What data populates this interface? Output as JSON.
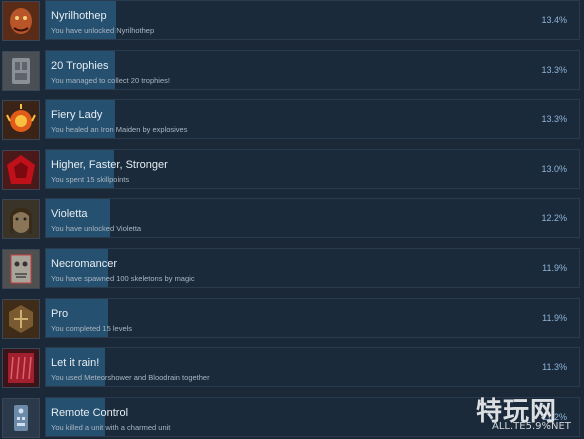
{
  "achievements": [
    {
      "title": "Nyrilhothep",
      "description": "You have unlocked Nyrilhothep",
      "percent": "13.4%",
      "rate": 13.4,
      "icon": "nyrilhothep-icon",
      "icon_color": "#b8562a"
    },
    {
      "title": "20 Trophies",
      "description": "You managed to collect 20 trophies!",
      "percent": "13.3%",
      "rate": 13.3,
      "icon": "trophies-icon",
      "icon_color": "#8a9098"
    },
    {
      "title": "Fiery Lady",
      "description": "You healed an Iron Maiden by explosives",
      "percent": "13.3%",
      "rate": 13.3,
      "icon": "fiery-lady-icon",
      "icon_color": "#e05a1a"
    },
    {
      "title": "Higher, Faster, Stronger",
      "description": "You spent 15 skillpoints",
      "percent": "13.0%",
      "rate": 13.0,
      "icon": "skillpoints-icon",
      "icon_color": "#c0101a"
    },
    {
      "title": "Violetta",
      "description": "You have unlocked Violetta",
      "percent": "12.2%",
      "rate": 12.2,
      "icon": "violetta-icon",
      "icon_color": "#8a7558"
    },
    {
      "title": "Necromancer",
      "description": "You have spawned 100 skeletons by magic",
      "percent": "11.9%",
      "rate": 11.9,
      "icon": "necromancer-icon",
      "icon_color": "#a8a49a"
    },
    {
      "title": "Pro",
      "description": "You completed 15 levels",
      "percent": "11.9%",
      "rate": 11.9,
      "icon": "pro-icon",
      "icon_color": "#7a5a30"
    },
    {
      "title": "Let it rain!",
      "description": "You used Meteorshower and Bloodrain together",
      "percent": "11.3%",
      "rate": 11.3,
      "icon": "let-it-rain-icon",
      "icon_color": "#a02030"
    },
    {
      "title": "Remote Control",
      "description": "You killed a unit with a charmed unit",
      "percent": "11.2%",
      "rate": 11.2,
      "icon": "remote-control-icon",
      "icon_color": "#6c8aa8"
    }
  ],
  "watermark": {
    "logo_text": "特玩网",
    "url": "ALL.TE5.9%NET"
  }
}
